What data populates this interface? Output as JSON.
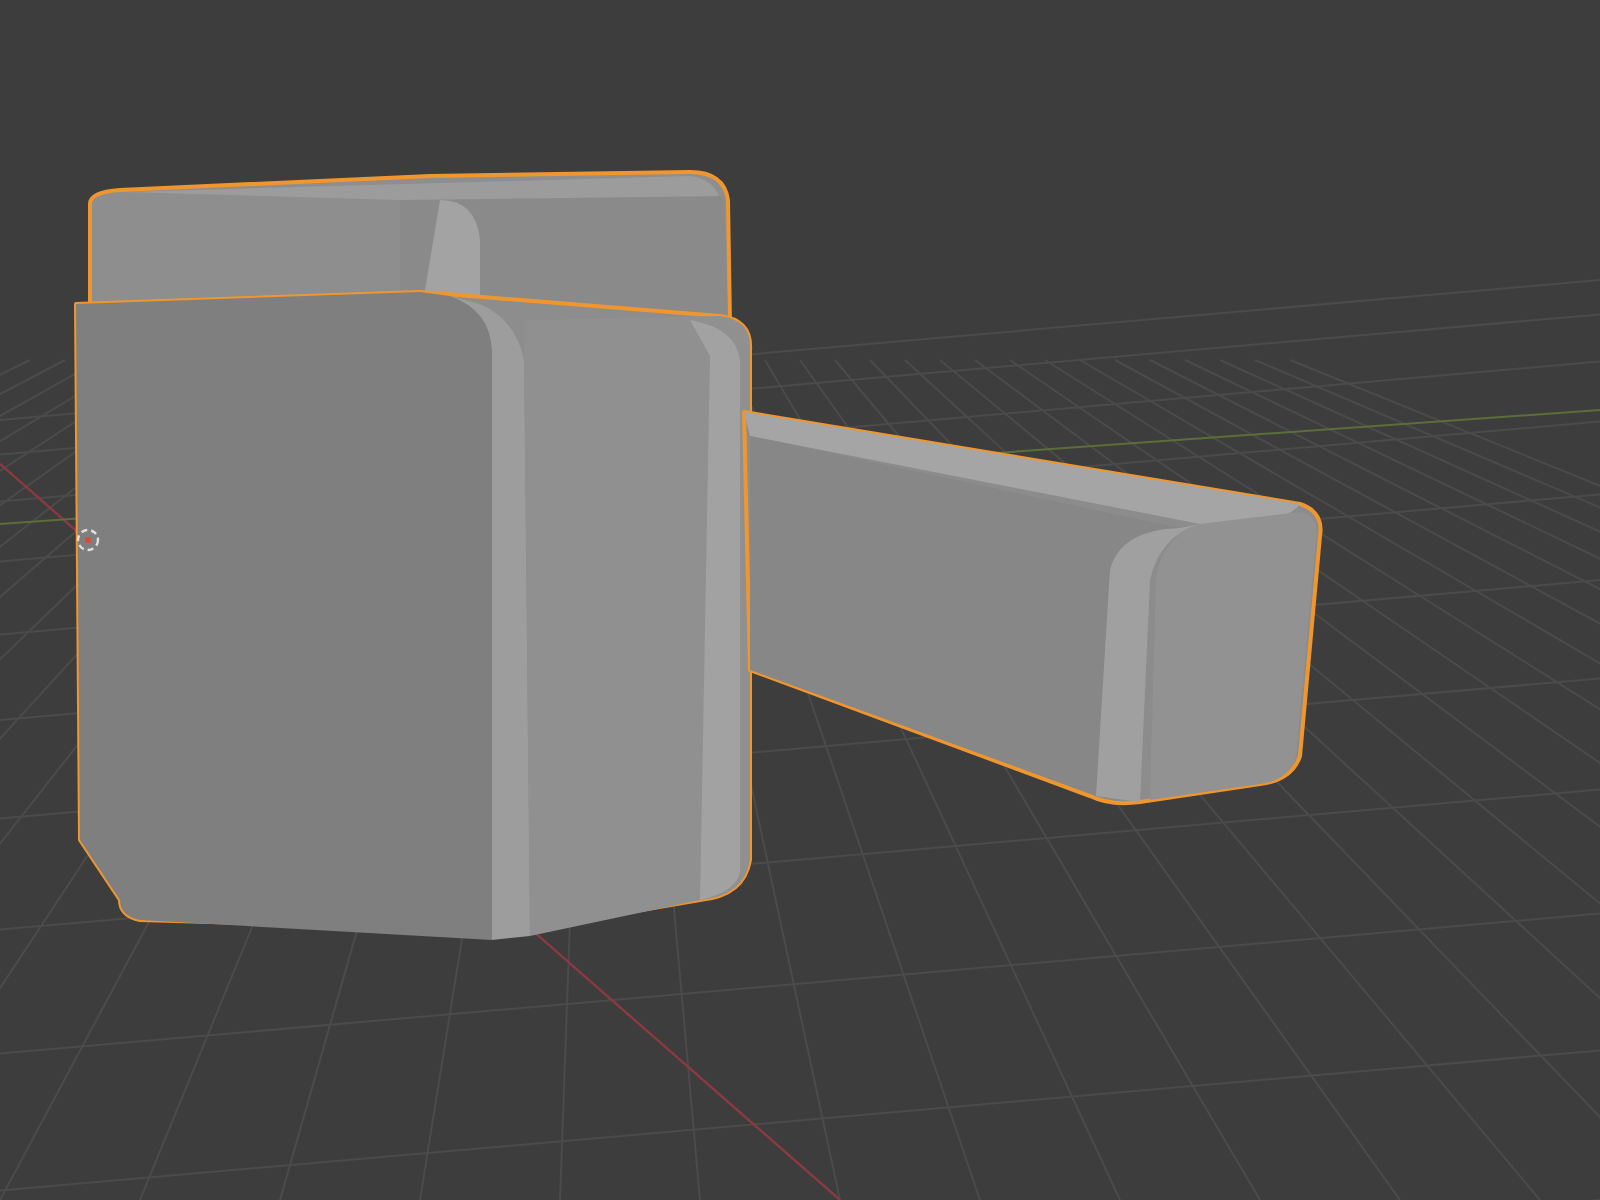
{
  "viewport": {
    "objects": [
      {
        "kind": "box",
        "selected": true
      },
      {
        "kind": "tray",
        "selected": true
      }
    ]
  }
}
